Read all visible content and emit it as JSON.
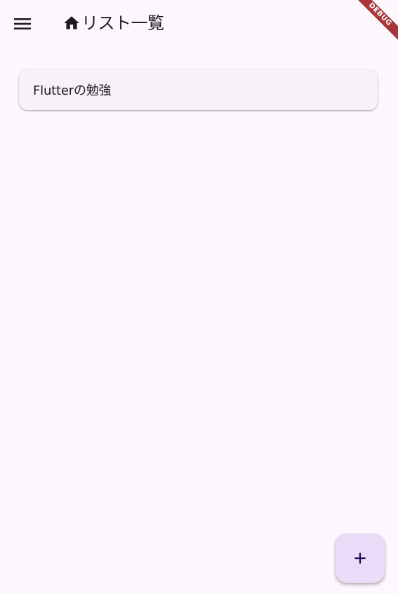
{
  "app_bar": {
    "menu_icon": "menu-icon",
    "title_icon": "home-icon",
    "title": "リスト一覧"
  },
  "debug_banner": {
    "label": "DEBUG",
    "color": "#a8363a"
  },
  "list": {
    "items": [
      {
        "title": "Flutterの勉強"
      }
    ]
  },
  "fab": {
    "icon": "add-icon",
    "background": "#eadcf8",
    "icon_color": "#21005d"
  },
  "theme": {
    "background": "#fdf8fe",
    "card_background": "#f7f1f9",
    "text": "#1d1b20"
  }
}
